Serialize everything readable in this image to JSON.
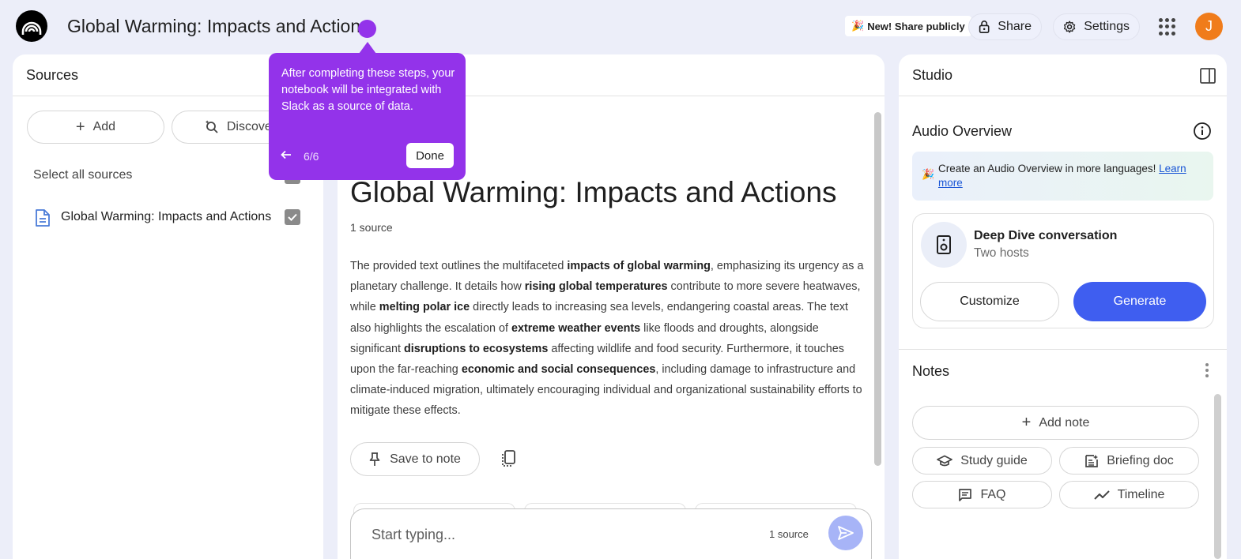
{
  "header": {
    "title": "Global Warming: Impacts and Actions",
    "new_share_label": "New! Share publicly",
    "new_share_emoji": "🎉",
    "share_label": "Share",
    "settings_label": "Settings",
    "avatar_initial": "J"
  },
  "sources": {
    "title": "Sources",
    "add_label": "Add",
    "discover_label": "Discover",
    "select_all_label": "Select all sources",
    "items": [
      {
        "label": "Global Warming: Impacts and Actions",
        "checked": true
      }
    ]
  },
  "chat": {
    "notebook_title": "Global Warming: Impacts and Actions",
    "source_count": "1 source",
    "summary": {
      "p1": "The provided text outlines the multifaceted ",
      "b1": "impacts of global warming",
      "p2": ", emphasizing its urgency as a planetary challenge. It details how ",
      "b2": "rising global temperatures",
      "p3": " contribute to more severe heatwaves, while ",
      "b3": "melting polar ice",
      "p4": " directly leads to increasing sea levels, endangering coastal areas. The text also highlights the escalation of ",
      "b4": "extreme weather events",
      "p5": " like floods and droughts, alongside significant ",
      "b5": "disruptions to ecosystems",
      "p6": " affecting wildlife and food security. Furthermore, it touches upon the far-reaching ",
      "b6": "economic and social consequences",
      "p7": ", including damage to infrastructure and climate-induced migration, ultimately encouraging individual and organizational sustainability efforts to mitigate these effects."
    },
    "save_to_note_label": "Save to note",
    "composer_placeholder": "Start typing...",
    "composer_source_count": "1 source"
  },
  "studio": {
    "title": "Studio",
    "audio_overview_title": "Audio Overview",
    "banner_emoji": "🎉",
    "banner_text": "Create an Audio Overview in more languages! ",
    "banner_link": "Learn more",
    "deep_dive_title": "Deep Dive conversation",
    "deep_dive_subtitle": "Two hosts",
    "customize_label": "Customize",
    "generate_label": "Generate",
    "notes_title": "Notes",
    "add_note_label": "Add note",
    "study_guide_label": "Study guide",
    "briefing_doc_label": "Briefing doc",
    "faq_label": "FAQ",
    "timeline_label": "Timeline"
  },
  "tooltip": {
    "text": "After completing these steps, your notebook will be integrated with Slack as a source of data.",
    "step": "6/6",
    "done_label": "Done"
  },
  "colors": {
    "accent_purple": "#9333ea",
    "primary_blue": "#3f5ef0",
    "avatar_orange": "#f07c1b",
    "background": "#eceef9"
  }
}
